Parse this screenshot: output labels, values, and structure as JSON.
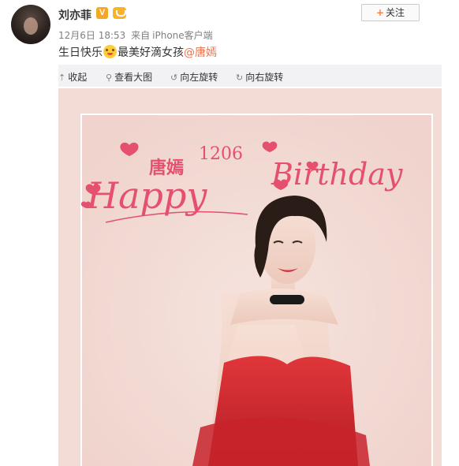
{
  "post": {
    "username": "刘亦菲",
    "verified_badge": "V",
    "follow_label": "关注",
    "date": "12月6日 18:53",
    "source_prefix": "来自",
    "source": "iPhone客户端",
    "text_before": "生日快乐",
    "text_after": "最美好滴女孩",
    "mention": "@唐嫣",
    "emoji_icon": "kiss-face-emoji"
  },
  "toolbar": {
    "collapse": "收起",
    "view_large": "查看大图",
    "rotate_left": "向左旋转",
    "rotate_right": "向右旋转"
  },
  "image": {
    "name_text": "唐嫣",
    "date_text": "1206",
    "line1": "Happy",
    "line2": "Birthday"
  },
  "colors": {
    "accent": "#eb7350",
    "follow_plus": "#ff8140",
    "toolbar_bg": "#f2f2f5",
    "photo_bg": "#f3dcd6",
    "title_pink": "#e4506e",
    "dress_red": "#d8282f"
  }
}
